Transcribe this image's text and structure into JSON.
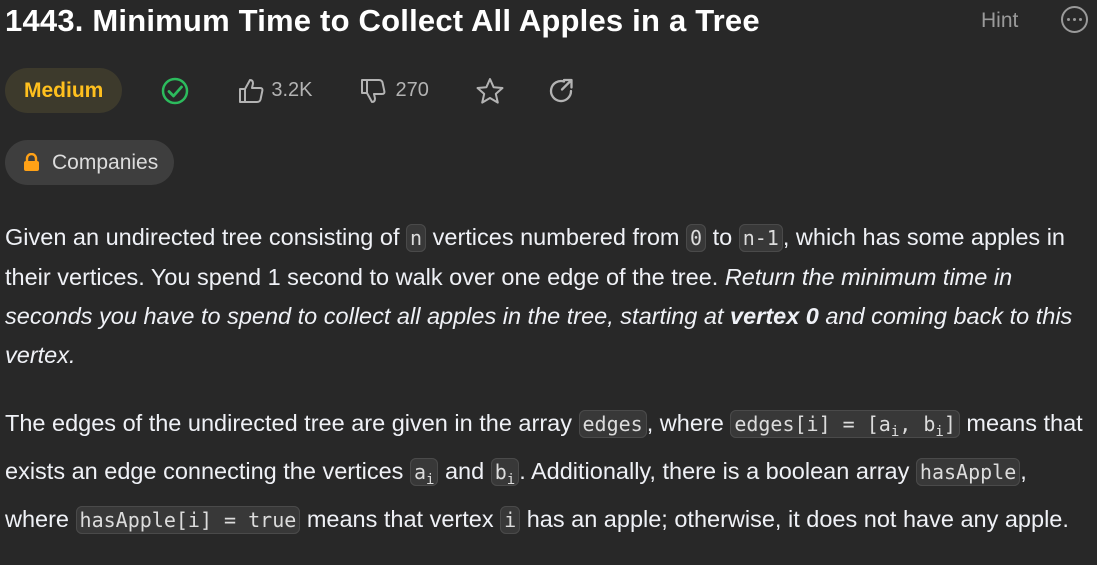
{
  "header": {
    "title": "1443. Minimum Time to Collect All Apples in a Tree",
    "hint_label": "Hint"
  },
  "meta": {
    "difficulty": "Medium",
    "likes": "3.2K",
    "dislikes": "270",
    "companies_label": "Companies"
  },
  "colors": {
    "difficulty": "#ffc01e",
    "solved_check": "#2cbb5d",
    "lock": "#ffa116"
  },
  "icons": [
    "more-icon",
    "check-circle-icon",
    "thumbs-up-icon",
    "thumbs-down-icon",
    "star-icon",
    "share-icon",
    "lock-icon"
  ],
  "description": {
    "p1": {
      "t1": "Given an undirected tree consisting of ",
      "c1": "n",
      "t2": " vertices numbered from ",
      "c2": "0",
      "t3": " to ",
      "c3": "n-1",
      "t4": ", which has some apples in their vertices. You spend 1 second to walk over one edge of the tree. ",
      "em1": "Return the minimum time in seconds you have to spend to collect all apples in the tree, starting at ",
      "strong": "vertex 0",
      "em2": " and coming back to this vertex."
    },
    "p2": {
      "t1": "The edges of the undirected tree are given in the array ",
      "c1": "edges",
      "t2": ", where ",
      "c2a": "edges[i] = [a",
      "c2s1": "i",
      "c2b": ", b",
      "c2s2": "i",
      "c2c": "]",
      "t3": " means that exists an edge connecting the vertices ",
      "c3": "a",
      "c3s": "i",
      "t4": " and ",
      "c4": "b",
      "c4s": "i",
      "t5": ". Additionally, there is a boolean array ",
      "c5": "hasApple",
      "t6": ", where ",
      "c6": "hasApple[i] = true",
      "t7": " means that vertex ",
      "c7": "i",
      "t8": " has an apple; otherwise, it does not have any apple."
    }
  }
}
